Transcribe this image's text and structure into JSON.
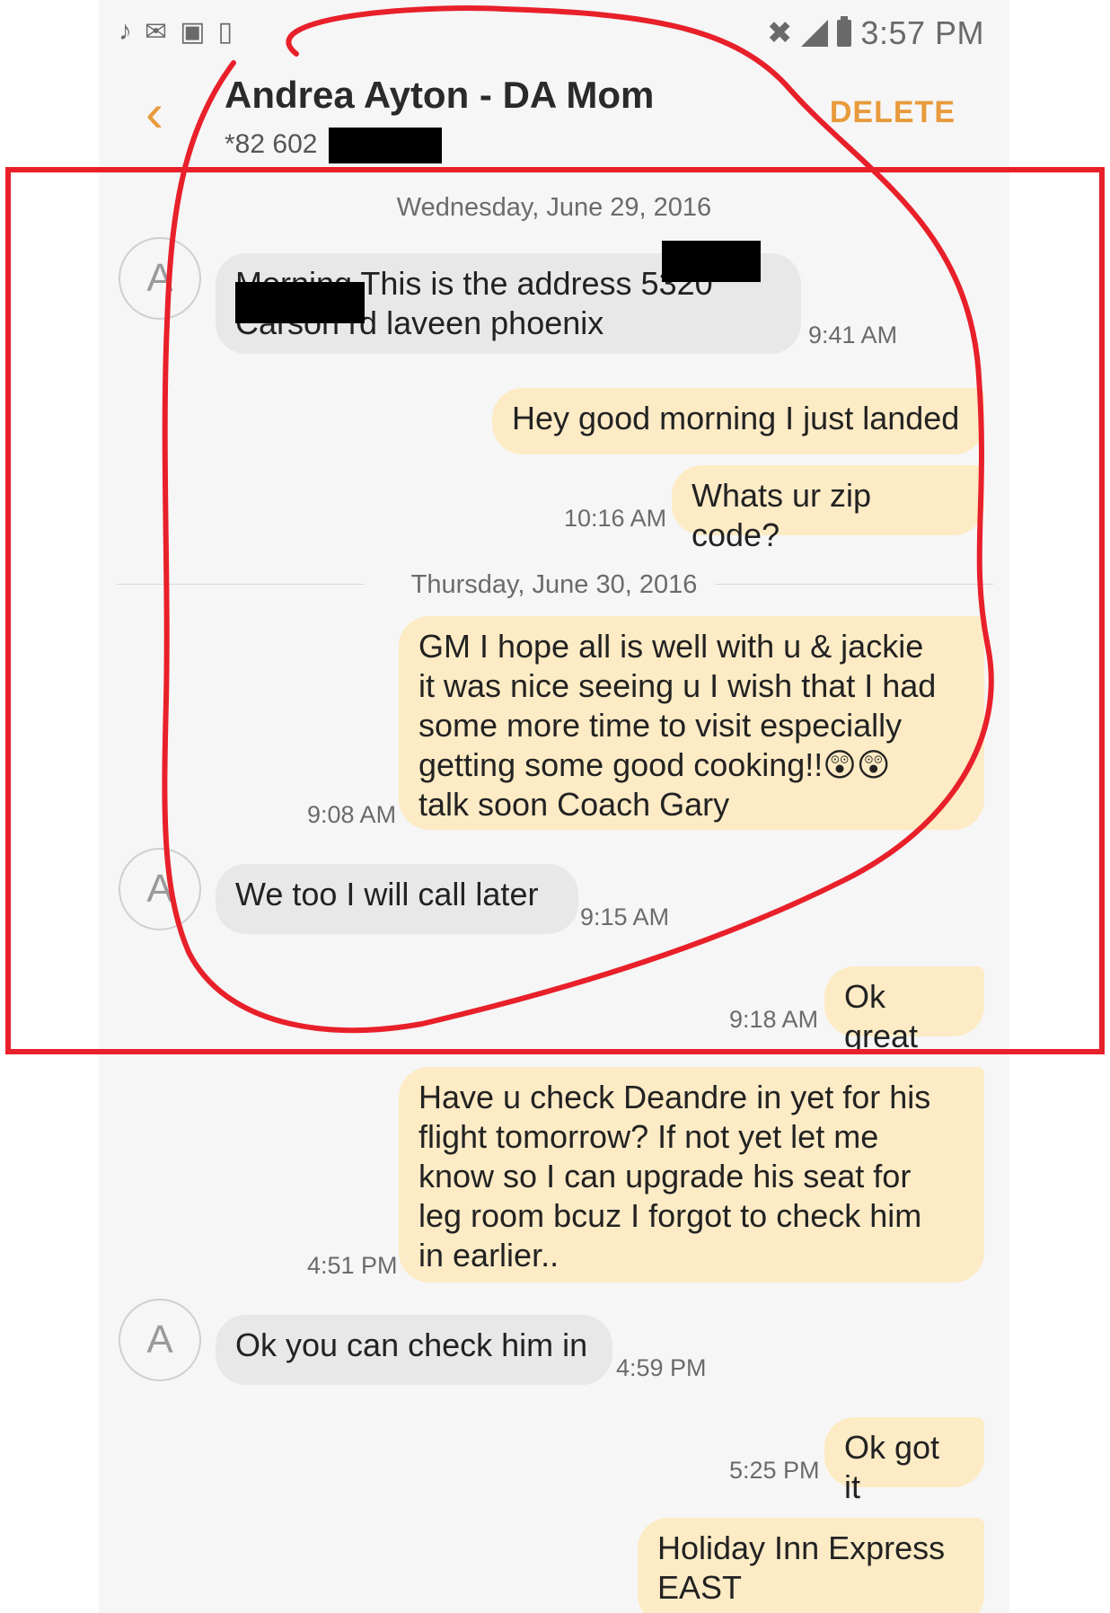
{
  "status_bar": {
    "time": "3:57 PM"
  },
  "header": {
    "title": "Andrea Ayton - DA Mom",
    "number_prefix": "*82 602",
    "delete_label": "DELETE"
  },
  "dates": {
    "day1": "Wednesday, June 29, 2016",
    "day2": "Thursday, June 30, 2016"
  },
  "contact": {
    "avatar_letter": "A"
  },
  "messages": [
    {
      "dir": "in",
      "lines": [
        "Morning  This is the address 5320",
        "Carson rd laveen phoenix"
      ],
      "time": "9:41 AM"
    },
    {
      "dir": "out",
      "lines": [
        "Hey good morning I just landed"
      ],
      "time": ""
    },
    {
      "dir": "out",
      "lines": [
        "Whats ur zip code?"
      ],
      "time": "10:16 AM"
    },
    {
      "dir": "out",
      "lines": [
        "GM I hope all is well with u & jackie",
        "it was nice seeing u I wish that I had",
        "some more time to visit especially",
        "getting some good cooking!!😲😲",
        "talk soon Coach Gary"
      ],
      "time": "9:08 AM"
    },
    {
      "dir": "in",
      "lines": [
        "We too I will call later"
      ],
      "time": "9:15 AM"
    },
    {
      "dir": "out",
      "lines": [
        "Ok great"
      ],
      "time": "9:18 AM"
    },
    {
      "dir": "out",
      "lines": [
        "Have u check Deandre in yet for his",
        "flight tomorrow? If not yet let me",
        "know so I can upgrade his seat for",
        "leg room bcuz I forgot to check him",
        "in earlier.."
      ],
      "time": "4:51 PM"
    },
    {
      "dir": "in",
      "lines": [
        "Ok you can check him in"
      ],
      "time": "4:59 PM"
    },
    {
      "dir": "out",
      "lines": [
        "Ok got it"
      ],
      "time": "5:25 PM"
    },
    {
      "dir": "out",
      "lines": [
        "Holiday Inn Express",
        "EAST"
      ],
      "time": ""
    }
  ],
  "icons": {
    "status_left": [
      "music-note-icon",
      "mail-icon",
      "message-icon",
      "phone-outline-icon"
    ],
    "status_right": [
      "mute-icon",
      "signal-icon",
      "battery-icon"
    ],
    "back": "chevron-left-icon"
  },
  "colors": {
    "accent": "#e89a3c",
    "incoming_bubble": "#e8e8e8",
    "outgoing_bubble": "#fdebc5",
    "annotation_red": "#e8202a"
  }
}
